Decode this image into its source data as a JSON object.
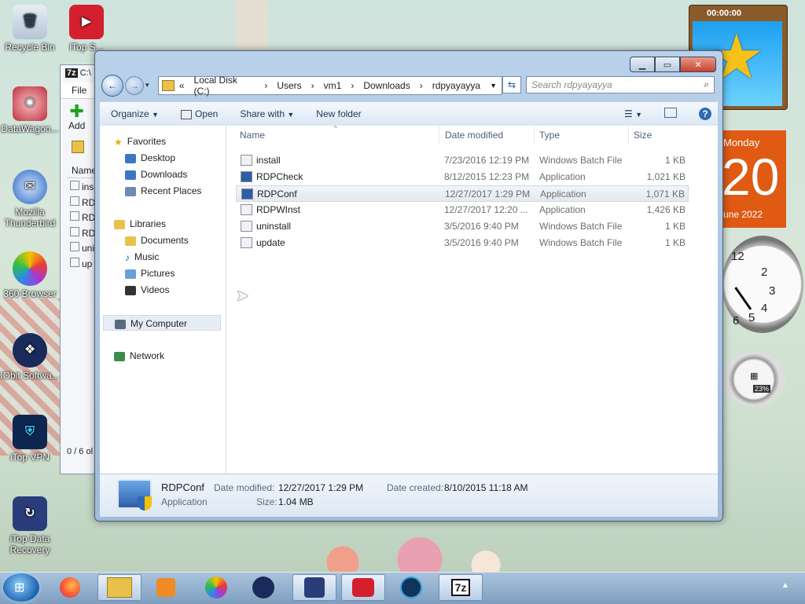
{
  "desktop_icons": [
    {
      "label": "Recycle Bin"
    },
    {
      "label": "iTop S..."
    },
    {
      "label": "DataWagon..."
    },
    {
      "label": "Mozilla Thunderbird"
    },
    {
      "label": "360 Browser"
    },
    {
      "label": "IObit Softwa..."
    },
    {
      "label": "iTop VPN"
    },
    {
      "label": "iTop Data Recovery"
    }
  ],
  "background_window": {
    "title": "C:\\",
    "menu_file": "File",
    "add_label": "Add",
    "col_name": "Name",
    "rows": [
      "ins",
      "RD",
      "RD",
      "RD",
      "uni",
      "up"
    ],
    "status": "0 / 6 ol"
  },
  "explorer": {
    "address": {
      "root_marker": "«",
      "crumbs": [
        "Local Disk (C:)",
        "Users",
        "vm1",
        "Downloads",
        "rdpyayayya"
      ]
    },
    "search_placeholder": "Search rdpyayayya",
    "toolbar": {
      "organize": "Organize",
      "open": "Open",
      "share_with": "Share with",
      "new_folder": "New folder"
    },
    "nav": {
      "favorites": "Favorites",
      "desktop": "Desktop",
      "downloads": "Downloads",
      "recent_places": "Recent Places",
      "libraries": "Libraries",
      "documents": "Documents",
      "music": "Music",
      "pictures": "Pictures",
      "videos": "Videos",
      "my_computer": "My Computer",
      "network": "Network"
    },
    "columns": {
      "name": "Name",
      "date": "Date modified",
      "type": "Type",
      "size": "Size"
    },
    "files": [
      {
        "name": "install",
        "date": "7/23/2016 12:19 PM",
        "type": "Windows Batch File",
        "size": "1 KB"
      },
      {
        "name": "RDPCheck",
        "date": "8/12/2015 12:23 PM",
        "type": "Application",
        "size": "1,021 KB"
      },
      {
        "name": "RDPConf",
        "date": "12/27/2017 1:29 PM",
        "type": "Application",
        "size": "1,071 KB"
      },
      {
        "name": "RDPWInst",
        "date": "12/27/2017 12:20 ...",
        "type": "Application",
        "size": "1,426 KB"
      },
      {
        "name": "uninstall",
        "date": "3/5/2016 9:40 PM",
        "type": "Windows Batch File",
        "size": "1 KB"
      },
      {
        "name": "update",
        "date": "3/5/2016 9:40 PM",
        "type": "Windows Batch File",
        "size": "1 KB"
      }
    ],
    "details": {
      "name": "RDPConf",
      "type": "Application",
      "date_modified_label": "Date modified:",
      "date_modified": "12/27/2017 1:29 PM",
      "size_label": "Size:",
      "size": "1.04 MB",
      "date_created_label": "Date created:",
      "date_created": "8/10/2015 11:18 AM"
    }
  },
  "widgets": {
    "timer": "00:00:00",
    "calendar_day_name": "Monday",
    "calendar_day": "20",
    "calendar_month": "une 2022",
    "meter_percent": "23%",
    "clock_numbers": [
      "12",
      "2",
      "3",
      "4",
      "5",
      "6"
    ]
  },
  "taskbar": {
    "seven_zip_label": "7z"
  }
}
